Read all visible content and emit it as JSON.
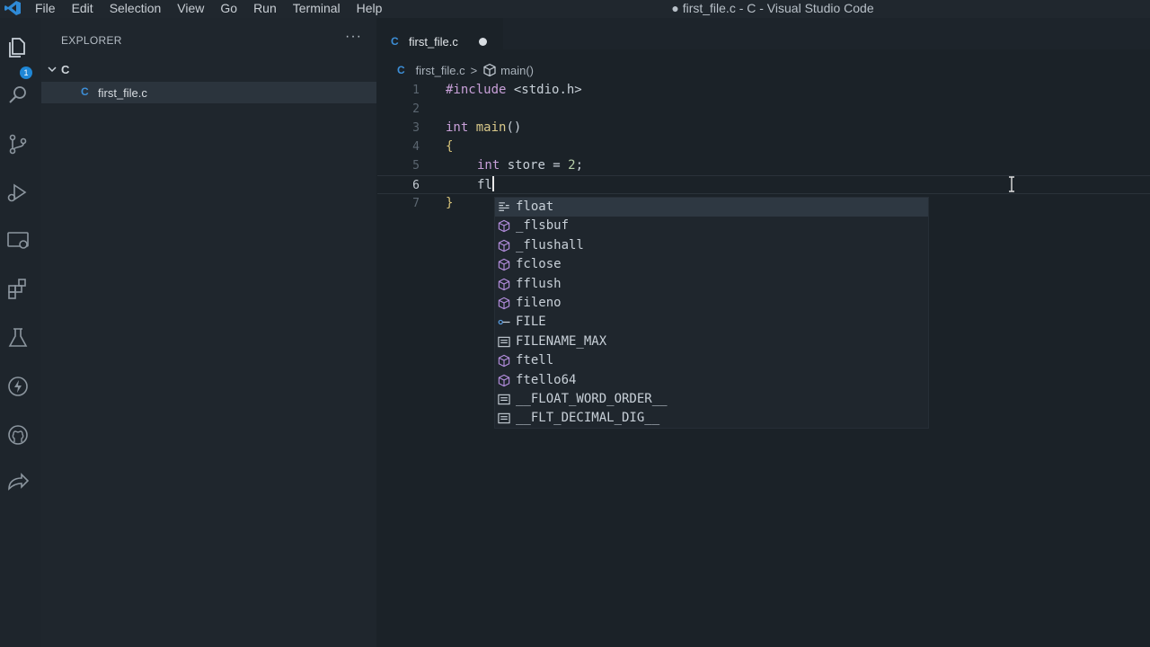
{
  "titlebar": {
    "menu": [
      "File",
      "Edit",
      "Selection",
      "View",
      "Go",
      "Run",
      "Terminal",
      "Help"
    ],
    "window_title": "● first_file.c - C - Visual Studio Code"
  },
  "activitybar": {
    "items": [
      "explorer-icon",
      "search-icon",
      "source-control-icon",
      "run-debug-icon",
      "remote-explorer-icon",
      "extensions-icon",
      "testing-icon",
      "lightning-icon",
      "github-icon",
      "live-share-icon"
    ],
    "explorer_badge": "1"
  },
  "sidebar": {
    "header": "EXPLORER",
    "more": "···",
    "folder": "C",
    "file": "first_file.c",
    "file_icon": "C"
  },
  "editor": {
    "tab": {
      "icon": "C",
      "name": "first_file.c"
    },
    "breadcrumb": {
      "icon": "C",
      "file": "first_file.c",
      "separator": ">",
      "symbol": "main()"
    },
    "lines": [
      {
        "n": "1",
        "code": "#include <stdio.h>"
      },
      {
        "n": "2",
        "code": ""
      },
      {
        "n": "3",
        "code": "int main()"
      },
      {
        "n": "4",
        "code": "{"
      },
      {
        "n": "5",
        "code": "int store = 2;"
      },
      {
        "n": "6",
        "code": "fl"
      },
      {
        "n": "7",
        "code": "}"
      }
    ],
    "current_line": 6
  },
  "suggest": {
    "items": [
      {
        "label": "float",
        "kind": "keyword"
      },
      {
        "label": "_flsbuf",
        "kind": "method"
      },
      {
        "label": "_flushall",
        "kind": "method"
      },
      {
        "label": "fclose",
        "kind": "method"
      },
      {
        "label": "fflush",
        "kind": "method"
      },
      {
        "label": "fileno",
        "kind": "method"
      },
      {
        "label": "FILE",
        "kind": "typeparam"
      },
      {
        "label": "FILENAME_MAX",
        "kind": "text"
      },
      {
        "label": "ftell",
        "kind": "method"
      },
      {
        "label": "ftello64",
        "kind": "method"
      },
      {
        "label": "__FLOAT_WORD_ORDER__",
        "kind": "text"
      },
      {
        "label": "__FLT_DECIMAL_DIG__",
        "kind": "text"
      }
    ],
    "selected_index": 0
  }
}
